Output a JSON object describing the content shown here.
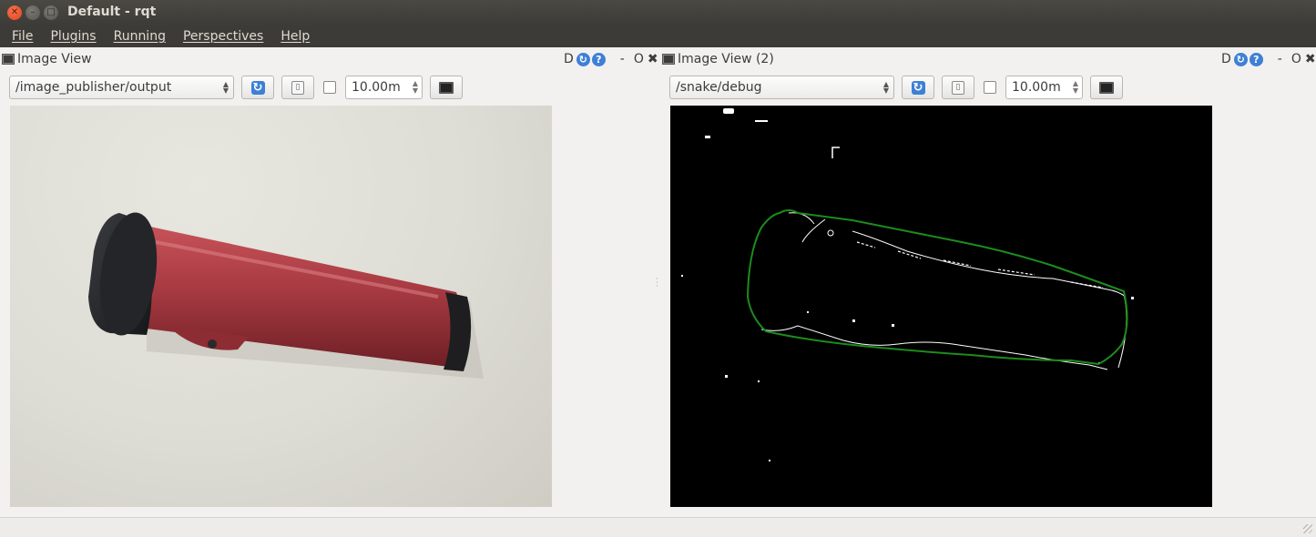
{
  "window": {
    "title": "Default - rqt"
  },
  "menu": [
    "File",
    "Plugins",
    "Running",
    "Perspectives",
    "Help"
  ],
  "panels": [
    {
      "title": "Image View",
      "controls": {
        "d_label": "D",
        "dash": "-",
        "o_label": "O",
        "close_label": "✖"
      },
      "topic": "/image_publisher/output",
      "zoom_value": "10.00m",
      "view": "photo"
    },
    {
      "title": "Image View (2)",
      "controls": {
        "d_label": "D",
        "dash": "-",
        "o_label": "O",
        "close_label": "✖"
      },
      "topic": "/snake/debug",
      "zoom_value": "10.00m",
      "view": "edge-debug"
    }
  ],
  "colors": {
    "titlebar": "#3c3b37",
    "close_button": "#e0441d",
    "accent_blue": "#3d80d6",
    "contour_green": "#1c8c1c"
  },
  "icons": [
    "refresh-icon",
    "help-icon",
    "save-icon",
    "monitor-icon",
    "close-icon"
  ]
}
